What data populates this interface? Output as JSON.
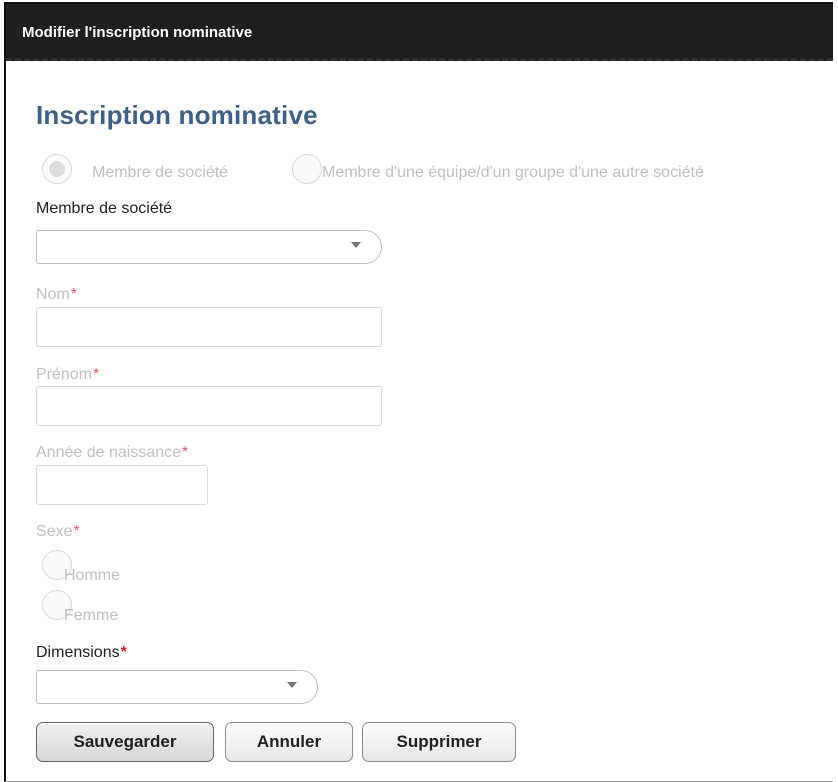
{
  "dialog": {
    "title": "Modifier l'inscription nominative"
  },
  "form": {
    "heading": "Inscription nominative",
    "member_type": {
      "options": [
        {
          "label": "Membre de société",
          "selected": true
        },
        {
          "label": "Membre d'une équipe/d'un groupe d'une autre société",
          "selected": false
        }
      ]
    },
    "member_select": {
      "label": "Membre de société",
      "value": ""
    },
    "nom": {
      "label": "Nom",
      "required_mark": "*",
      "value": ""
    },
    "prenom": {
      "label": "Prénom",
      "required_mark": "*",
      "value": ""
    },
    "annee": {
      "label": "Année de naissance",
      "required_mark": "*",
      "value": ""
    },
    "sexe": {
      "label": "Sexe",
      "required_mark": "*",
      "options": [
        "Homme",
        "Femme"
      ]
    },
    "dimensions": {
      "label": "Dimensions",
      "required_mark": "*",
      "value": ""
    }
  },
  "buttons": {
    "save": "Sauvegarder",
    "cancel": "Annuler",
    "delete": "Supprimer"
  },
  "colors": {
    "titlebar_bg": "#1e1f21",
    "heading": "#3d6184",
    "required": "#d62020",
    "disabled_text": "#c0c0c0"
  }
}
